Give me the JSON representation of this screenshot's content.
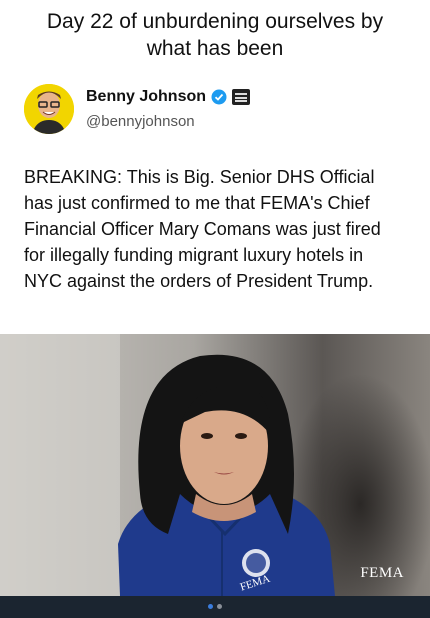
{
  "caption": {
    "line1": "Day 22 of unburdening ourselves by",
    "line2": "what has been"
  },
  "author": {
    "name": "Benny Johnson",
    "handle": "@bennyjohnson",
    "avatar_bg": "#f2d500",
    "verified_color": "#1d9bf0",
    "icons": [
      "verified-badge-icon",
      "affiliate-badge-icon"
    ]
  },
  "tweet": {
    "lines": [
      "BREAKING: This is Big. Senior DHS Official",
      "has just confirmed to me that FEMA's Chief",
      "Financial Officer Mary Comans was just fired",
      "for illegally funding migrant luxury hotels in",
      "NYC against the orders of President Trump."
    ]
  },
  "media": {
    "corner_label": "FEMA",
    "jacket_text": "FEMA",
    "jacket_color": "#1f3a8c"
  },
  "pager": {
    "active_color": "#3b7ddd",
    "inactive_color": "#8a9099",
    "count": 2,
    "active_index": 0
  }
}
